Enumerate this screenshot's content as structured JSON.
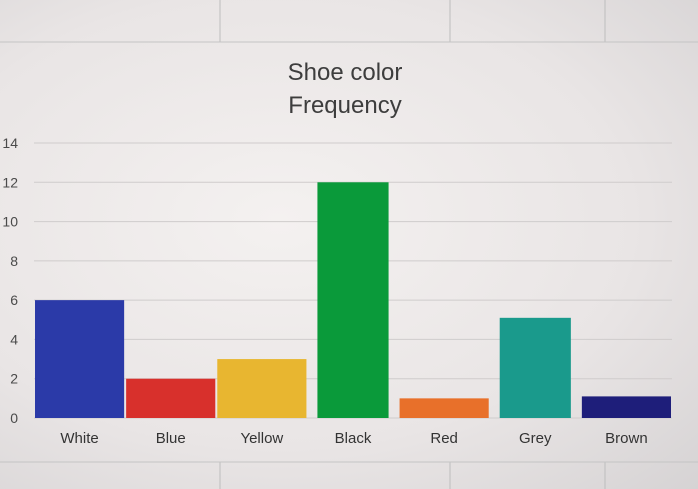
{
  "chart_data": {
    "type": "bar",
    "title_lines": [
      "Shoe color",
      "Frequency"
    ],
    "categories": [
      "White",
      "Blue",
      "Yellow",
      "Black",
      "Red",
      "Grey",
      "Brown"
    ],
    "values": [
      6,
      2,
      3,
      12,
      1,
      5.1,
      1.1
    ],
    "colors": [
      "#2b3aa8",
      "#d8302c",
      "#e8b630",
      "#0a9a3a",
      "#e8702a",
      "#1a9a8c",
      "#1e1e7a"
    ],
    "ylim": [
      0,
      14
    ],
    "yticks": [
      0,
      2,
      4,
      6,
      8,
      10,
      12,
      14
    ],
    "grid": true,
    "legend": "none"
  }
}
